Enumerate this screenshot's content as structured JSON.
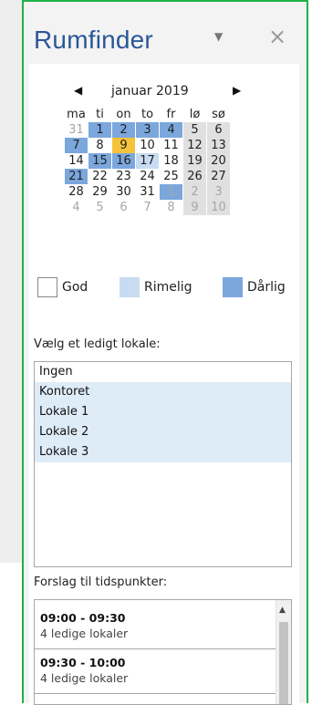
{
  "pane": {
    "title": "Rumfinder",
    "menu_icon": "dropdown-arrow-icon",
    "close_icon": "close-icon",
    "menu_glyph": "▼",
    "close_glyph": "×"
  },
  "calendar": {
    "month_label": "januar 2019",
    "prev_glyph": "◀",
    "next_glyph": "▶",
    "weekdays": [
      "ma",
      "ti",
      "on",
      "to",
      "fr",
      "lø",
      "sø"
    ],
    "weeks": [
      [
        {
          "d": "31",
          "t": "muted"
        },
        {
          "d": "1",
          "t": "dark"
        },
        {
          "d": "2",
          "t": "dark"
        },
        {
          "d": "3",
          "t": "dark"
        },
        {
          "d": "4",
          "t": "dark"
        },
        {
          "d": "5",
          "t": "we"
        },
        {
          "d": "6",
          "t": "we"
        }
      ],
      [
        {
          "d": "7",
          "t": "dark"
        },
        {
          "d": "8",
          "t": ""
        },
        {
          "d": "9",
          "t": "today"
        },
        {
          "d": "10",
          "t": ""
        },
        {
          "d": "11",
          "t": ""
        },
        {
          "d": "12",
          "t": "we"
        },
        {
          "d": "13",
          "t": "we"
        }
      ],
      [
        {
          "d": "14",
          "t": ""
        },
        {
          "d": "15",
          "t": "dark"
        },
        {
          "d": "16",
          "t": "dark"
        },
        {
          "d": "17",
          "t": "mid"
        },
        {
          "d": "18",
          "t": ""
        },
        {
          "d": "19",
          "t": "we"
        },
        {
          "d": "20",
          "t": "we"
        }
      ],
      [
        {
          "d": "21",
          "t": "dark"
        },
        {
          "d": "22",
          "t": ""
        },
        {
          "d": "23",
          "t": ""
        },
        {
          "d": "24",
          "t": ""
        },
        {
          "d": "25",
          "t": ""
        },
        {
          "d": "26",
          "t": "we"
        },
        {
          "d": "27",
          "t": "we"
        }
      ],
      [
        {
          "d": "28",
          "t": ""
        },
        {
          "d": "29",
          "t": ""
        },
        {
          "d": "30",
          "t": ""
        },
        {
          "d": "31",
          "t": ""
        },
        {
          "d": "1",
          "t": "selmuted"
        },
        {
          "d": "2",
          "t": "wemuted"
        },
        {
          "d": "3",
          "t": "wemuted"
        }
      ],
      [
        {
          "d": "4",
          "t": "muted"
        },
        {
          "d": "5",
          "t": "muted"
        },
        {
          "d": "6",
          "t": "muted"
        },
        {
          "d": "7",
          "t": "muted"
        },
        {
          "d": "8",
          "t": "muted"
        },
        {
          "d": "9",
          "t": "wemuted"
        },
        {
          "d": "10",
          "t": "wemuted"
        }
      ]
    ]
  },
  "legend": [
    {
      "label": "God",
      "color": "#ffffff"
    },
    {
      "label": "Rimelig",
      "color": "#c8dbf1"
    },
    {
      "label": "Dårlig",
      "color": "#7ba7dd"
    }
  ],
  "rooms": {
    "label": "Vælg et ledigt lokale:",
    "items": [
      {
        "name": "Ingen",
        "available": false
      },
      {
        "name": "Kontoret",
        "available": true
      },
      {
        "name": "Lokale 1",
        "available": true
      },
      {
        "name": "Lokale 2",
        "available": true
      },
      {
        "name": "Lokale 3",
        "available": true
      }
    ]
  },
  "suggestions": {
    "label": "Forslag til tidspunkter:",
    "items": [
      {
        "time": "09:00 - 09:30",
        "detail": "4 ledige lokaler"
      },
      {
        "time": "09:30 - 10:00",
        "detail": "4 ledige lokaler"
      }
    ],
    "scroll_up_glyph": "▲"
  },
  "colors": {
    "accent_border": "#1eb04a",
    "title": "#2b5797",
    "busy": "#7ba7dd",
    "partial": "#c8dbf1",
    "today": "#f5c33b"
  }
}
